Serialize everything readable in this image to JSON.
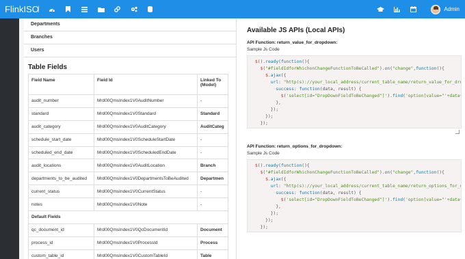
{
  "app": {
    "brand": "FlinkISO",
    "admin_label": "Admin"
  },
  "nav": {
    "left_icons": [
      "dashboard-icon",
      "bookmark-icon",
      "list-icon",
      "folder-icon",
      "link-icon",
      "gears-icon",
      "database-icon"
    ],
    "right_icons": [
      "graduation-cap-icon",
      "bar-chart-icon",
      "calendar-icon"
    ]
  },
  "relations": [
    "Departments",
    "Branches",
    "Users"
  ],
  "table_fields": {
    "title": "Table Fields",
    "headers": {
      "name": "Field Name",
      "id": "Field Id",
      "linked": "Linked To (Model)"
    },
    "rows": [
      {
        "name": "audit_number",
        "id": "Mrd00QmsIndex1V0AuditNumber",
        "linked": "-",
        "bold": false
      },
      {
        "name": "standard",
        "id": "Mrd00QmsIndex1V0Standard",
        "linked": "Standard",
        "bold": true
      },
      {
        "name": "audit_category",
        "id": "Mrd00QmsIndex1V0AuditCategory",
        "linked": "AuditCateg",
        "bold": true
      },
      {
        "name": "schedule_start_date",
        "id": "Mrd00QmsIndex1V0ScheduleStartDate",
        "linked": "-",
        "bold": false
      },
      {
        "name": "scheduled_end_date",
        "id": "Mrd00QmsIndex1V0ScheduledEndDate",
        "linked": "-",
        "bold": false
      },
      {
        "name": "audit_locations",
        "id": "Mrd00QmsIndex1V0AuditLocation",
        "linked": "Branch",
        "bold": true
      },
      {
        "name": "departments_to_be_audited",
        "id": "Mrd00QmsIndex1V0DepartmentsToBeAudited",
        "linked": "Departmen",
        "bold": true
      },
      {
        "name": "current_status",
        "id": "Mrd00QmsIndex1V0CurrentStatus",
        "linked": "-",
        "bold": false
      },
      {
        "name": "notes",
        "id": "Mrd00QmsIndex1V0Note",
        "linked": "-",
        "bold": false
      }
    ],
    "default_fields_label": "Default Fields",
    "default_rows": [
      {
        "name": "qc_document_id",
        "id": "Mrd00QmsIndex1V0QcDocumentId",
        "linked": "Document",
        "bold": true
      },
      {
        "name": "process_id",
        "id": "Mrd00QmsIndex1V0ProcessId",
        "linked": "Process",
        "bold": true
      },
      {
        "name": "custom_table_id",
        "id": "Mrd00QmsIndex1V0CustomTableId",
        "linked": "Table",
        "bold": true
      }
    ]
  },
  "apis": {
    "title": "Available JS APIs (Local APIs)",
    "functions": [
      {
        "title": "API Function: return_value_for_dropdown:",
        "subtitle": "Sample Js Code",
        "code": "$().ready(function(){\n  $(\"#fieldIdforWhichonChangeFunctionToBeCalled\").on(\"change\",function(){\n    $.ajax({\n      url: \"http(s)://your_local_address/current_table_name/return_value_for_dropdown\",\n        success: function(data, result) {\n          $('select[id=\"DropDownFieldToBeChanged\"]').find('option[value=\"'+data+'\"]')\n        },\n      });\n    });\n  });\n});"
      },
      {
        "title": "API Function: return_options_for_dropdown:",
        "subtitle": "Sample Js Code",
        "code": "$().ready(function(){\n  $(\"#fieldIdforWhichonChangeFunctionToBeCalled\").on(\"change\",function(){\n    $.ajax({\n      url: \"http(s)://your_local_address/current_table_name/return_options_for_dropdown\",\n        success: function(data, result) {\n          $('select[id=\"DropDownFieldToBeChanged\"]').find('option[value=\"'+data+'\"]')\n        },\n      });\n    });\n  });\n});"
      }
    ]
  }
}
